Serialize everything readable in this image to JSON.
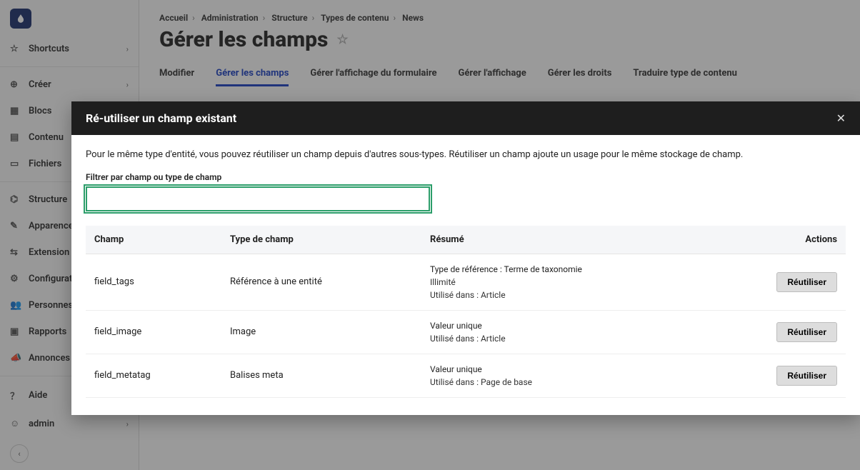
{
  "sidebar": {
    "shortcuts": "Shortcuts",
    "items": [
      {
        "label": "Créer",
        "chev": true
      },
      {
        "label": "Blocs"
      },
      {
        "label": "Contenu"
      },
      {
        "label": "Fichiers"
      }
    ],
    "items2": [
      {
        "label": "Structure"
      },
      {
        "label": "Apparence"
      },
      {
        "label": "Extension"
      },
      {
        "label": "Configuration"
      },
      {
        "label": "Personnes"
      },
      {
        "label": "Rapports"
      },
      {
        "label": "Annonces"
      }
    ],
    "bottom": [
      {
        "label": "Aide"
      },
      {
        "label": "admin",
        "chev": true
      }
    ]
  },
  "breadcrumb": [
    "Accueil",
    "Administration",
    "Structure",
    "Types de contenu",
    "News"
  ],
  "page_title": "Gérer les champs",
  "tabs": [
    {
      "label": "Modifier"
    },
    {
      "label": "Gérer les champs",
      "active": true
    },
    {
      "label": "Gérer l'affichage du formulaire"
    },
    {
      "label": "Gérer l'affichage"
    },
    {
      "label": "Gérer les droits"
    },
    {
      "label": "Traduire type de contenu"
    }
  ],
  "modal": {
    "title": "Ré-utiliser un champ existant",
    "description": "Pour le même type d'entité, vous pouvez réutiliser un champ depuis d'autres sous-types. Réutiliser un champ ajoute un usage pour le même stockage de champ.",
    "filter_label": "Filtrer par champ ou type de champ",
    "columns": {
      "field": "Champ",
      "type": "Type de champ",
      "summary": "Résumé",
      "actions": "Actions"
    },
    "reuse_label": "Réutiliser",
    "rows": [
      {
        "field": "field_tags",
        "type": "Référence à une entité",
        "summary_line1": "Type de référence : Terme de taxonomie",
        "summary_line2": "Illimité",
        "summary_line3": "Utilisé dans : Article"
      },
      {
        "field": "field_image",
        "type": "Image",
        "summary_line1": "Valeur unique",
        "summary_line2": "Utilisé dans : Article",
        "summary_line3": ""
      },
      {
        "field": "field_metatag",
        "type": "Balises meta",
        "summary_line1": "Valeur unique",
        "summary_line2": "Utilisé dans : Page de base",
        "summary_line3": ""
      }
    ]
  }
}
